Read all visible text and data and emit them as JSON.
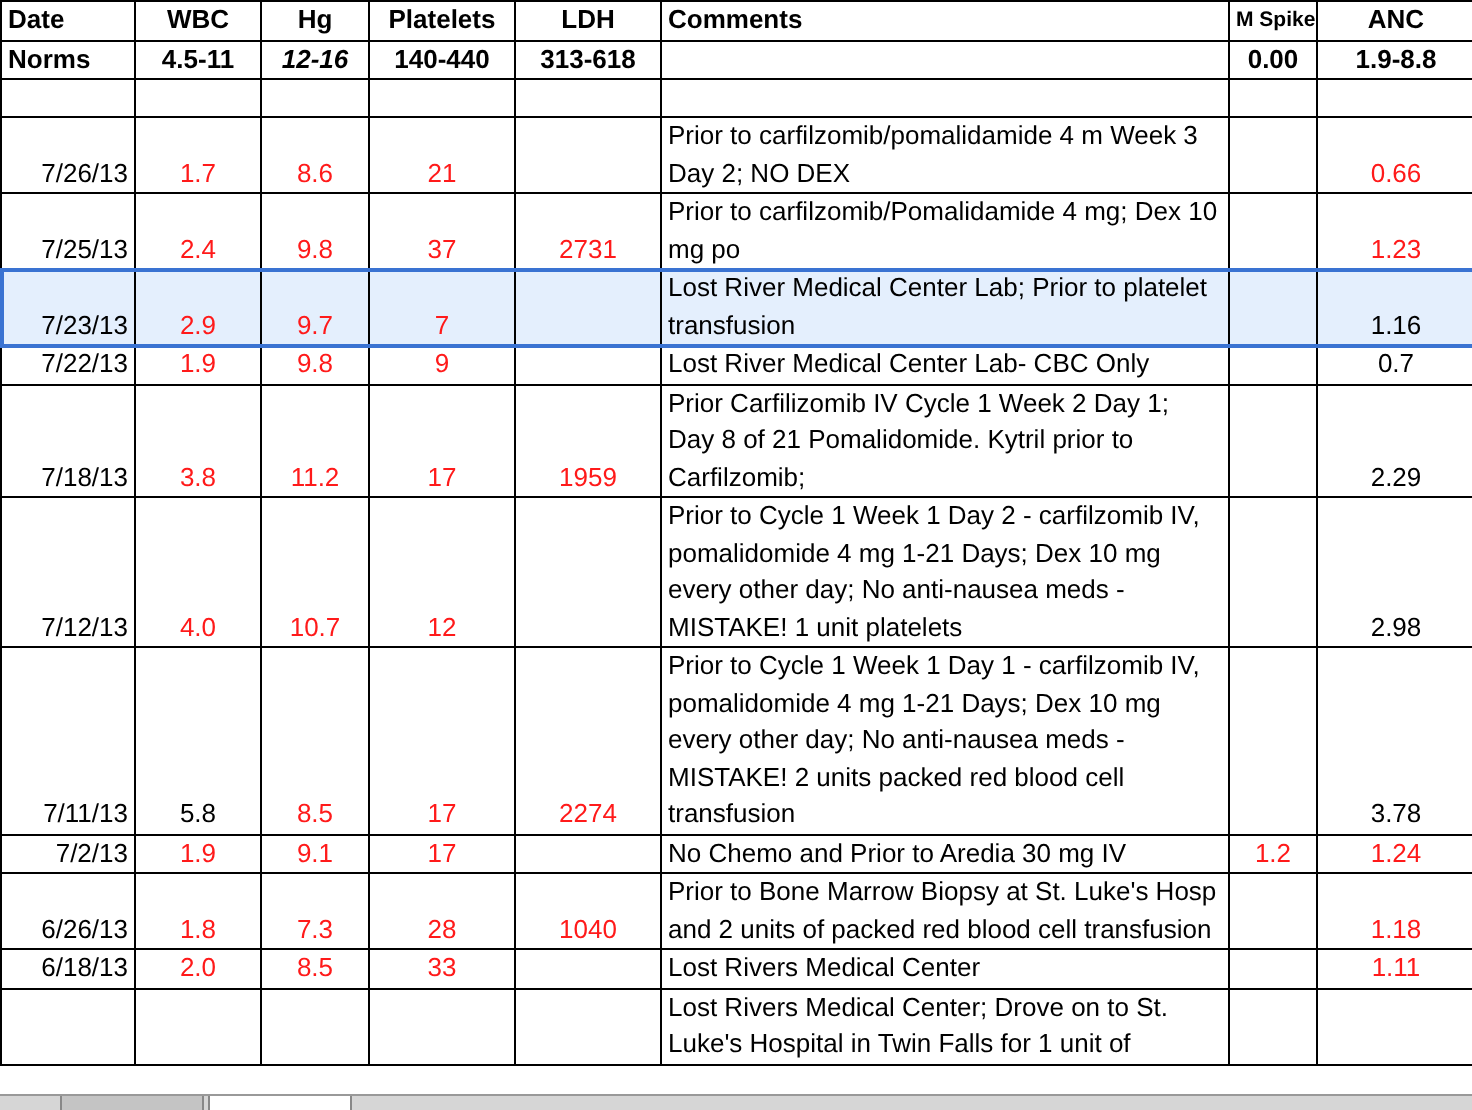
{
  "columns": [
    {
      "label": "Date",
      "kind": "date",
      "small": false
    },
    {
      "label": "WBC",
      "kind": "number",
      "small": false
    },
    {
      "label": "Hg",
      "kind": "number",
      "small": false
    },
    {
      "label": "Platelets",
      "kind": "number",
      "small": false
    },
    {
      "label": "LDH",
      "kind": "number",
      "small": false
    },
    {
      "label": "Comments",
      "kind": "text",
      "small": false
    },
    {
      "label": "M Spike",
      "kind": "number",
      "small": true
    },
    {
      "label": "ANC",
      "kind": "number",
      "small": false
    }
  ],
  "norms": {
    "label": "Norms",
    "values": [
      {
        "text": "4.5-11",
        "italic": false
      },
      {
        "text": "12-16",
        "italic": true
      },
      {
        "text": "140-440",
        "italic": false
      },
      {
        "text": "313-618",
        "italic": false
      },
      {
        "text": "0.00",
        "italic": false
      },
      {
        "text": "1.9-8.8",
        "italic": false
      }
    ]
  },
  "rows": [
    {
      "kind": "spacer",
      "selected": false
    },
    {
      "kind": "entry",
      "selected": false,
      "date": "7/26/13",
      "cells": [
        {
          "text": "1.7",
          "abnormal": true
        },
        {
          "text": "8.6",
          "abnormal": true
        },
        {
          "text": "21",
          "abnormal": true
        },
        null,
        {
          "text": "Prior to carfilzomib/pomalidamide 4 m Week 3 Day 2; NO DEX",
          "abnormal": false
        },
        null,
        {
          "text": "0.66",
          "abnormal": true
        }
      ]
    },
    {
      "kind": "entry",
      "selected": false,
      "date": "7/25/13",
      "cells": [
        {
          "text": "2.4",
          "abnormal": true
        },
        {
          "text": "9.8",
          "abnormal": true
        },
        {
          "text": "37",
          "abnormal": true
        },
        {
          "text": "2731",
          "abnormal": true
        },
        {
          "text": "Prior to carfilzomib/Pomalidamide 4 mg; Dex 10 mg po",
          "abnormal": false
        },
        null,
        {
          "text": "1.23",
          "abnormal": true
        }
      ]
    },
    {
      "kind": "entry",
      "selected": true,
      "date": "7/23/13",
      "cells": [
        {
          "text": "2.9",
          "abnormal": true
        },
        {
          "text": "9.7",
          "abnormal": true
        },
        {
          "text": "7",
          "abnormal": true
        },
        null,
        {
          "text": "Lost River Medical Center Lab; Prior to platelet transfusion",
          "abnormal": false
        },
        null,
        {
          "text": "1.16",
          "abnormal": false
        }
      ]
    },
    {
      "kind": "entry",
      "selected": false,
      "date": "7/22/13",
      "cells": [
        {
          "text": "1.9",
          "abnormal": true
        },
        {
          "text": "9.8",
          "abnormal": true
        },
        {
          "text": "9",
          "abnormal": true
        },
        null,
        {
          "text": "Lost River Medical Center Lab- CBC Only",
          "abnormal": false
        },
        null,
        {
          "text": "0.7",
          "abnormal": false
        }
      ]
    },
    {
      "kind": "entry",
      "selected": false,
      "date": "7/18/13",
      "cells": [
        {
          "text": "3.8",
          "abnormal": true
        },
        {
          "text": "11.2",
          "abnormal": true
        },
        {
          "text": "17",
          "abnormal": true
        },
        {
          "text": "1959",
          "abnormal": true
        },
        {
          "text": "Prior Carfilizomib IV Cycle 1 Week 2 Day 1; Day 8 of 21 Pomalidomide. Kytril prior to Carfilzomib;",
          "abnormal": false
        },
        null,
        {
          "text": "2.29",
          "abnormal": false
        }
      ]
    },
    {
      "kind": "entry",
      "selected": false,
      "date": "7/12/13",
      "cells": [
        {
          "text": "4.0",
          "abnormal": true
        },
        {
          "text": "10.7",
          "abnormal": true
        },
        {
          "text": "12",
          "abnormal": true
        },
        null,
        {
          "text": "Prior to Cycle 1 Week 1 Day 2 - carfilzomib IV, pomalidomide 4 mg 1-21 Days; Dex 10 mg every other day; No anti-nausea meds - MISTAKE! 1 unit platelets",
          "abnormal": false
        },
        null,
        {
          "text": "2.98",
          "abnormal": false
        }
      ]
    },
    {
      "kind": "entry",
      "selected": false,
      "date": "7/11/13",
      "cells": [
        {
          "text": "5.8",
          "abnormal": false
        },
        {
          "text": "8.5",
          "abnormal": true
        },
        {
          "text": "17",
          "abnormal": true
        },
        {
          "text": "2274",
          "abnormal": true
        },
        {
          "text": "Prior to Cycle 1 Week 1 Day 1 - carfilzomib IV, pomalidomide 4 mg 1-21 Days; Dex 10 mg every other day; No anti-nausea meds - MISTAKE! 2 units packed red blood cell transfusion",
          "abnormal": false
        },
        null,
        {
          "text": "3.78",
          "abnormal": false
        }
      ]
    },
    {
      "kind": "entry",
      "selected": false,
      "date": "7/2/13",
      "cells": [
        {
          "text": "1.9",
          "abnormal": true
        },
        {
          "text": "9.1",
          "abnormal": true
        },
        {
          "text": "17",
          "abnormal": true
        },
        null,
        {
          "text": "No Chemo and Prior to Aredia 30 mg IV",
          "abnormal": false
        },
        {
          "text": "1.2",
          "abnormal": true
        },
        {
          "text": "1.24",
          "abnormal": true
        }
      ]
    },
    {
      "kind": "entry",
      "selected": false,
      "date": "6/26/13",
      "cells": [
        {
          "text": "1.8",
          "abnormal": true
        },
        {
          "text": "7.3",
          "abnormal": true
        },
        {
          "text": "28",
          "abnormal": true
        },
        {
          "text": "1040",
          "abnormal": true
        },
        {
          "text": "Prior to Bone Marrow Biopsy at St. Luke's Hosp and 2 units of packed red blood cell transfusion",
          "abnormal": false
        },
        null,
        {
          "text": "1.18",
          "abnormal": true
        }
      ]
    },
    {
      "kind": "entry",
      "selected": false,
      "date": "6/18/13",
      "cells": [
        {
          "text": "2.0",
          "abnormal": true
        },
        {
          "text": "8.5",
          "abnormal": true
        },
        {
          "text": "33",
          "abnormal": true
        },
        null,
        {
          "text": "Lost Rivers Medical Center",
          "abnormal": false
        },
        null,
        {
          "text": "1.11",
          "abnormal": true
        }
      ]
    },
    {
      "kind": "partial",
      "selected": false,
      "cells": [
        null,
        null,
        null,
        null,
        {
          "text": "Lost Rivers Medical Center; Drove on to St. Luke's Hospital in Twin Falls for 1 unit of",
          "abnormal": false
        },
        null,
        null
      ]
    }
  ]
}
